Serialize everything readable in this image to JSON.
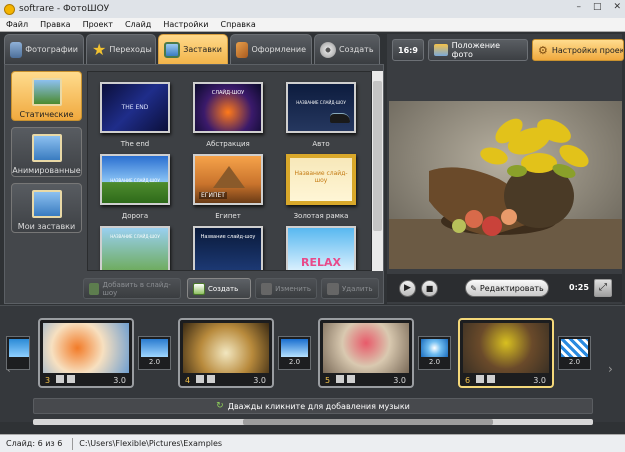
{
  "window": {
    "title": "softrare - ФотоШОУ",
    "minimize": "–",
    "maximize": "□",
    "close": "✕"
  },
  "menu": [
    "Файл",
    "Правка",
    "Проект",
    "Слайд",
    "Настройки",
    "Справка"
  ],
  "tabs": [
    {
      "label": "Фотографии",
      "icon": "photos-icon",
      "color": "#6b8fb8"
    },
    {
      "label": "Переходы",
      "icon": "star-icon",
      "color": "#f2c230"
    },
    {
      "label": "Заставки",
      "icon": "title-screen-icon",
      "color": "#7fb1e6",
      "active": true
    },
    {
      "label": "Оформление",
      "icon": "design-icon",
      "color": "#d9893b"
    },
    {
      "label": "Создать",
      "icon": "film-reel-icon",
      "color": "#bdbdbd"
    }
  ],
  "categories": [
    {
      "label": "Статические",
      "active": true
    },
    {
      "label": "Анимированные"
    },
    {
      "label": "Мои заставки"
    }
  ],
  "thumbnails": [
    {
      "label": "The end",
      "caption": "THE END",
      "bg": "linear-gradient(135deg,#0b0f3a,#1f2d8a,#0b0f3a)"
    },
    {
      "label": "Абстракция",
      "caption": "СЛАЙД-ШОУ",
      "bg": "radial-gradient(circle at 50% 60%,#ff7a1a,#3b1a6b 55%,#0a0a2a)"
    },
    {
      "label": "Авто",
      "caption": "НАЗВАНИЕ СЛАЙД-ШОУ",
      "bg": "linear-gradient(#0d1c3e,#25375f)"
    },
    {
      "label": "Дорога",
      "caption": "НАЗВАНИЕ СЛАЙД-ШОУ",
      "bg": "linear-gradient(#2a6fd0,#8cc5f5 55%,#4e8c2e 56%,#2e6a1a)"
    },
    {
      "label": "Египет",
      "caption": "ЕГИПЕТ",
      "bg": "linear-gradient(#f6a34a,#c9732c 60%,#6b3b16)"
    },
    {
      "label": "Золотая рамка",
      "caption": "Название слайд-шоу",
      "bg": "linear-gradient(#f7e8b9,#fff6d6)"
    },
    {
      "label": "",
      "caption": "НАЗВАНИЕ СЛАЙД-ШОУ",
      "bg": "linear-gradient(#9ad0f0,#6aa84f)"
    },
    {
      "label": "",
      "caption": "Название слайд-шоу",
      "bg": "linear-gradient(#0a1a3a,#1e3c7a)"
    },
    {
      "label": "",
      "caption": "RELAX",
      "bg": "linear-gradient(#58b8f0,#e8f6ff)"
    }
  ],
  "actions": {
    "add": "Добавить в слайд-шоу",
    "create": "Создать",
    "edit": "Изменить",
    "delete": "Удалить"
  },
  "right_toolbar": {
    "ratio": "16:9",
    "photo_position": "Положение фото",
    "project_settings": "Настройки проекта"
  },
  "player": {
    "edit": "Редактировать",
    "time": "0:25"
  },
  "slides": [
    {
      "num": "3",
      "dur": "3.0",
      "bg": "radial-gradient(circle at 40% 50%,#f27b28,#f7e0c0 45%,#6f9fd0)"
    },
    {
      "num": "4",
      "dur": "3.0",
      "bg": "radial-gradient(circle at 50% 60%,#f2e7c0,#b88a3c 50%,#3a2a14)"
    },
    {
      "num": "5",
      "dur": "3.0",
      "bg": "radial-gradient(circle at 50% 40%,#e85a6a,#d9c9b0 45%,#7a6a58)"
    },
    {
      "num": "6",
      "dur": "3.0",
      "bg": "radial-gradient(circle at 50% 40%,#d8c020,#6a4a2a 50%,#3a3024)",
      "selected": true
    }
  ],
  "transitions": [
    {
      "dur": "2.0",
      "bg": "linear-gradient(#2b8ad6,#8fd0ff)"
    },
    {
      "dur": "2.0",
      "bg": "linear-gradient(#2a7bd0,#9fd6ff)"
    },
    {
      "dur": "2.0",
      "bg": "linear-gradient(#1a6fd0,#b6e2ff)"
    },
    {
      "dur": "2.0",
      "bg": "radial-gradient(circle,#ffffff,#6fbcf0 40%,#1a6bbd)"
    },
    {
      "dur": "2.0",
      "bg": "repeating-linear-gradient(45deg,#2a8ae0 0 3px,#ffffff 3px 6px)"
    }
  ],
  "music_hint": "Дважды кликните для добавления музыки",
  "status": {
    "slide": "Слайд: 6 из 6",
    "path": "C:\\Users\\Flexible\\Pictures\\Examples"
  }
}
